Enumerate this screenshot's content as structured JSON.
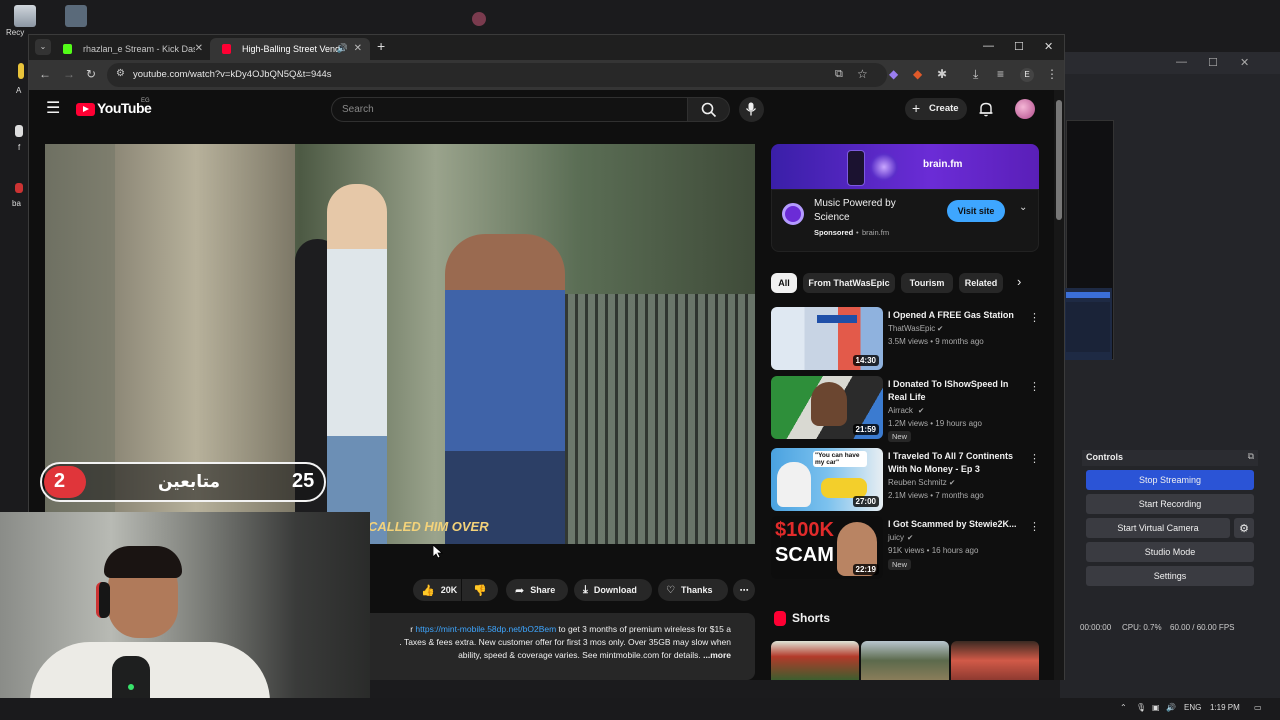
{
  "desktop": {
    "icons": [
      {
        "name": "recycle-bin",
        "label": "Recy"
      },
      {
        "name": "app-a",
        "label": "A"
      },
      {
        "name": "app-f",
        "label": "f"
      },
      {
        "name": "app-ba",
        "label": "ba"
      }
    ]
  },
  "browser": {
    "tabs": [
      {
        "title": "rhazlan_e Stream - Kick Dashbo",
        "active": false
      },
      {
        "title": "High-Balling Street Vendor",
        "active": true
      }
    ],
    "url": "youtube.com/watch?v=kDy4OJbQN5Q&t=944s",
    "profile_letter": "E"
  },
  "youtube": {
    "logo_text": "YouTube",
    "country": "EG",
    "search_placeholder": "Search",
    "create_label": "Create",
    "video": {
      "caption": "CALLED HIM OVER"
    },
    "actions": {
      "like_count": "20K",
      "share_label": "Share",
      "download_label": "Download",
      "thanks_label": "Thanks"
    },
    "description": {
      "line1_prefix": "r ",
      "line1_link": "https://mint-mobile.58dp.net/bO2Bem",
      "line1_suffix": " to get 3 months of premium wireless for $15 a",
      "line2": ". Taxes & fees extra. New customer offer for first 3 mos only. Over 35GB may slow when",
      "line3": "ability, speed & coverage varies. See mintmobile.com for details.",
      "more": " ...more"
    },
    "ad": {
      "brand": "brain.fm",
      "title": "Music Powered by Science",
      "sponsored": "Sponsored",
      "domain": "brain.fm",
      "cta": "Visit site"
    },
    "chips": [
      "All",
      "From ThatWasEpic",
      "Tourism",
      "Related"
    ],
    "recommendations": [
      {
        "title": "I Opened A FREE Gas Station",
        "channel": "ThatWasEpic",
        "meta": "3.5M views • 9 months ago",
        "duration": "14:30",
        "is_new": false
      },
      {
        "title": "I Donated To IShowSpeed In Real Life",
        "channel": "Airrack",
        "meta": "1.2M views • 19 hours ago",
        "duration": "21:59",
        "is_new": true
      },
      {
        "title": "I Traveled To All 7 Continents With No Money - Ep 3",
        "channel": "Reuben Schmitz",
        "meta": "2.1M views • 7 months ago",
        "duration": "27:00",
        "is_new": false
      },
      {
        "title": "I Got Scammed by Stewie2K...",
        "channel": "juicy",
        "meta": "91K views • 16 hours ago",
        "duration": "22:19",
        "is_new": true
      }
    ],
    "new_label": "New",
    "shorts_label": "Shorts",
    "thumb_texts": {
      "car": "\"You can have my car\"",
      "scam_amount": "$100K",
      "scam_word": "SCAM"
    }
  },
  "stream_overlay": {
    "left_number": "2",
    "label": "متابعين",
    "right_number": "25"
  },
  "obs": {
    "controls_title": "Controls",
    "buttons": [
      "Stop Streaming",
      "Start Recording",
      "Start Virtual Camera",
      "Studio Mode",
      "Settings"
    ],
    "timer": "00:00:00",
    "cpu": "CPU: 0.7%",
    "fps": "60.00 / 60.00 FPS"
  },
  "taskbar": {
    "language": "ENG",
    "time": "1:19 PM"
  },
  "colors": {
    "youtube_red": "#ff0033",
    "link_blue": "#3ea6ff",
    "obs_stop": "#2b54d6"
  }
}
